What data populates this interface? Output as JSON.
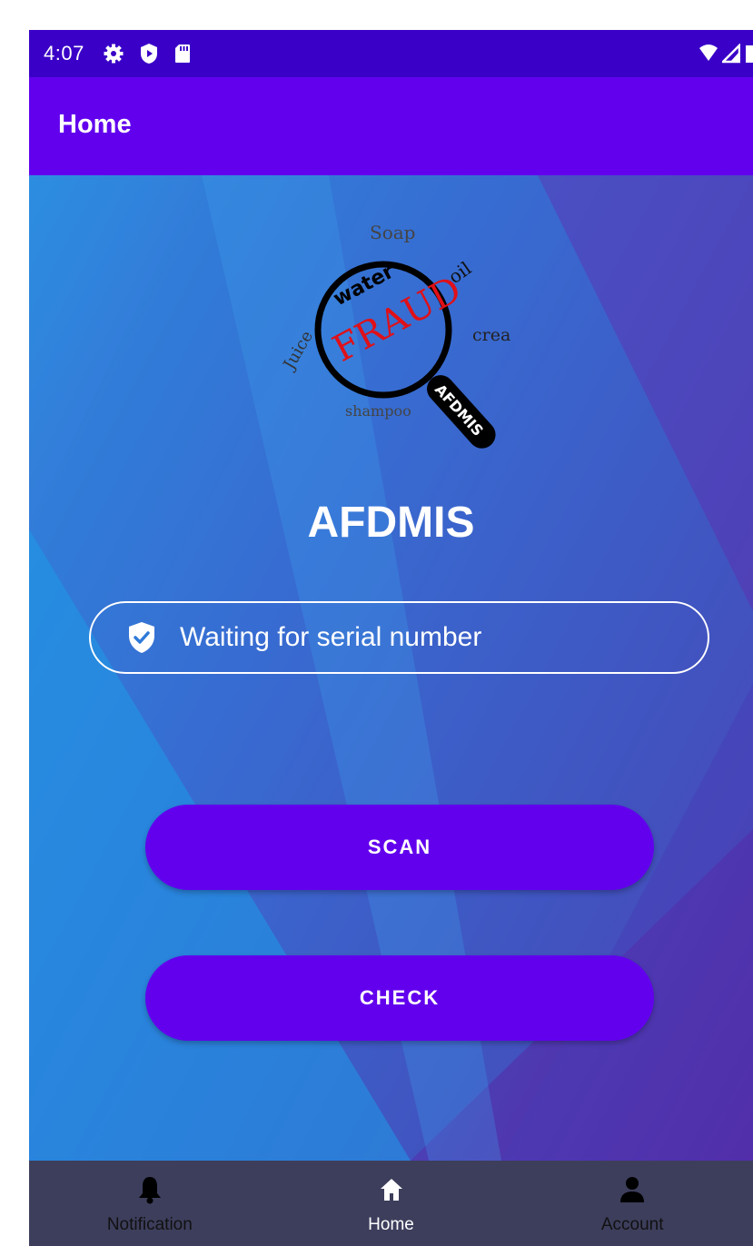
{
  "status_bar": {
    "time": "4:07",
    "left_icons": [
      "gear-icon",
      "shield-play-icon",
      "sd-card-icon"
    ],
    "right_icons": [
      "wifi-icon",
      "signal-icon",
      "battery-icon"
    ]
  },
  "app_bar": {
    "title": "Home",
    "color": "#6200ee"
  },
  "logo": {
    "center_word": "FRAUD",
    "words": [
      "Soap",
      "oil",
      "water",
      "cream",
      "Juice",
      "shampoo",
      "AFDMIS"
    ]
  },
  "brand_title": "AFDMIS",
  "status_message": {
    "icon": "verified-shield-icon",
    "text": "Waiting for serial number"
  },
  "buttons": {
    "scan_label": "SCAN",
    "check_label": "CHECK",
    "color": "#6200ee"
  },
  "bottom_nav": {
    "items": [
      {
        "label": "Notification",
        "icon": "bell-icon",
        "active": false
      },
      {
        "label": "Home",
        "icon": "home-icon",
        "active": true
      },
      {
        "label": "Account",
        "icon": "person-icon",
        "active": false
      }
    ]
  }
}
